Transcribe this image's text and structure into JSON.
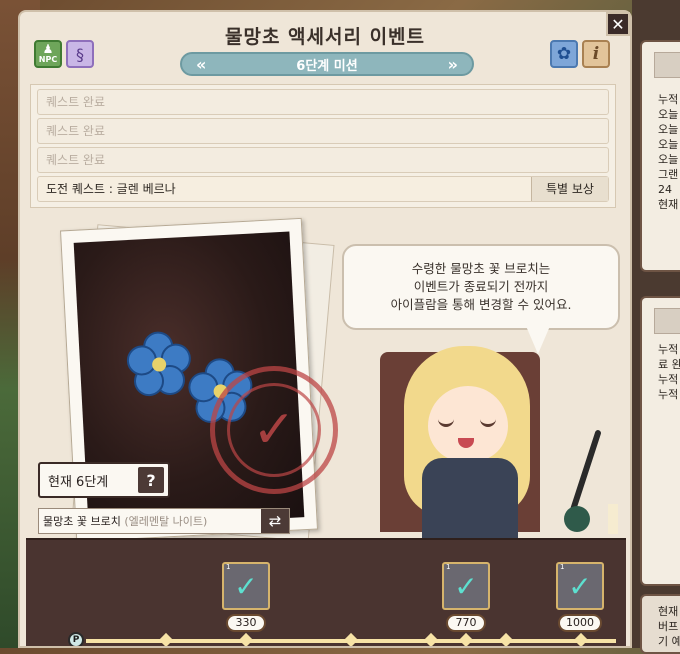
{
  "window": {
    "title": "물망초 액세서리 이벤트",
    "mission_label": "6단계 미션",
    "prev_symbol": "«",
    "next_symbol": "»",
    "close_symbol": "✕"
  },
  "icons": {
    "npc_label": "NPC",
    "info_symbol": "i",
    "quill_symbol": "§",
    "flower_symbol": "✿"
  },
  "quests": {
    "completed": [
      "퀘스트 완료",
      "퀘스트 완료",
      "퀘스트 완료"
    ],
    "challenge": "도전 퀘스트 : 글렌 베르나",
    "special_reward_button": "특별 보상"
  },
  "dialogue": {
    "lines": [
      "수령한 물망초 꽃 브로치는",
      "이벤트가 종료되기 전까지",
      "아이플람을 통해 변경할 수 있어요."
    ]
  },
  "stage": {
    "current_label": "현재 6단계",
    "help_symbol": "?"
  },
  "reward_field": {
    "prefix": "물망초 꽃 브로치",
    "suffix": "(엘레멘탈 나이트)",
    "swap_symbol": "⇄"
  },
  "progress": {
    "start_badge": "P",
    "rewards": [
      {
        "count": "1",
        "score": "330"
      },
      {
        "count": "1",
        "score": "770"
      },
      {
        "count": "1",
        "score": "1000"
      }
    ]
  },
  "side_panel": {
    "top_lines": [
      "누적",
      "오늘",
      "오늘",
      "오늘",
      "오늘",
      "그랜",
      "24",
      "현재"
    ],
    "mid_lines": [
      "누적",
      "료 완",
      "누적",
      "누적"
    ],
    "bottom_lines": [
      "현재",
      "버프",
      "기 예"
    ]
  },
  "colors": {
    "mission_bar": "#8eb6bc",
    "window_bg": "#efe6d8",
    "progress_bg": "#4a3430",
    "stamp": "#bc4646"
  }
}
